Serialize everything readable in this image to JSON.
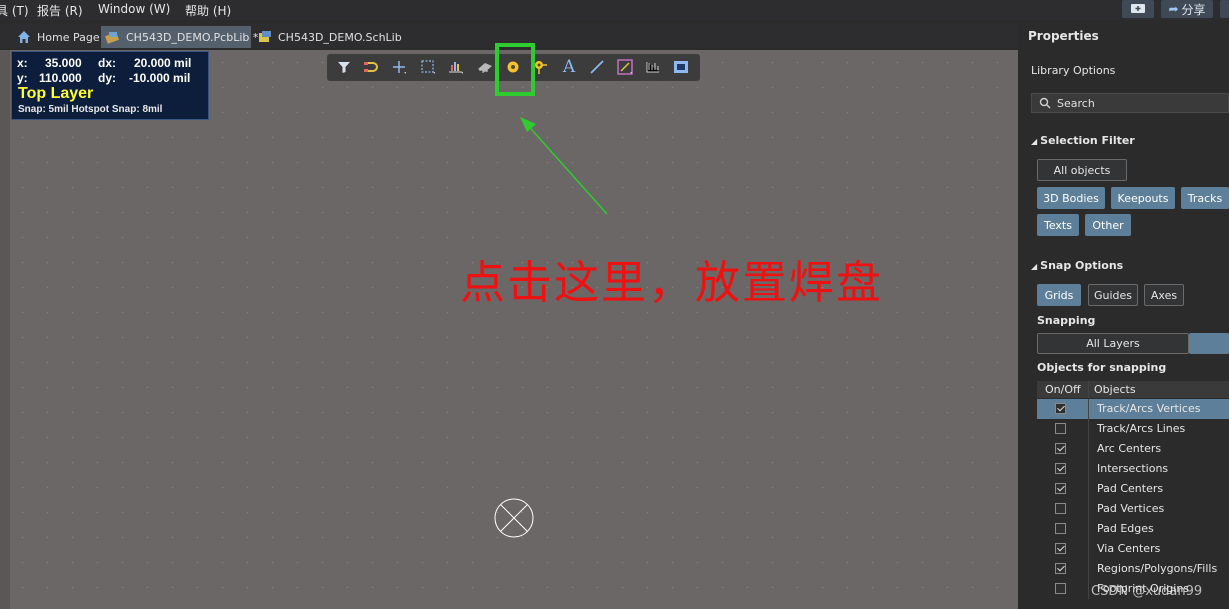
{
  "menubar": {
    "items": [
      "具 (T)",
      "报告 (R)",
      "Window (W)",
      "帮助 (H)"
    ],
    "share_label": "分享"
  },
  "tabs": [
    {
      "label": "Home Page",
      "icon": "home-icon"
    },
    {
      "label": "CH543D_DEMO.PcbLib *",
      "icon": "pcblib-icon"
    },
    {
      "label": "CH543D_DEMO.SchLib",
      "icon": "schlib-icon"
    }
  ],
  "hud": {
    "x_label": "x:",
    "x_value": "35.000",
    "dx_label": "dx:",
    "dx_value": "20.000 mil",
    "y_label": "y:",
    "y_value": "110.000",
    "dy_label": "dy:",
    "dy_value": "-10.000 mil",
    "layer": "Top Layer",
    "snap": "Snap: 5mil Hotspot Snap: 8mil"
  },
  "toolbar": {
    "tools": [
      "filter-icon",
      "interactive-route-icon",
      "place-component-icon",
      "select-rect-icon",
      "chart-icon",
      "component-icon",
      "place-pad-icon",
      "place-via-icon",
      "place-text-icon",
      "place-line-icon",
      "place-region-icon",
      "dimension-icon",
      "layer-icon"
    ]
  },
  "annotation": {
    "text": "点击这里，放置焊盘"
  },
  "properties": {
    "title": "Properties",
    "library_options": "Library Options",
    "search_placeholder": "Search",
    "selection_filter": {
      "heading": "Selection Filter",
      "all_objects": "All objects",
      "buttons": [
        "3D Bodies",
        "Keepouts",
        "Tracks",
        "Texts",
        "Other"
      ]
    },
    "snap_options": {
      "heading": "Snap Options",
      "buttons": [
        "Grids",
        "Guides",
        "Axes"
      ],
      "snapping_label": "Snapping",
      "snapping_value": "All Layers",
      "objects_label": "Objects for snapping",
      "col_onoff": "On/Off",
      "col_objects": "Objects",
      "objects": [
        {
          "label": "Track/Arcs Vertices",
          "checked": true,
          "selected": true
        },
        {
          "label": "Track/Arcs Lines",
          "checked": false
        },
        {
          "label": "Arc Centers",
          "checked": true
        },
        {
          "label": "Intersections",
          "checked": true
        },
        {
          "label": "Pad Centers",
          "checked": true
        },
        {
          "label": "Pad Vertices",
          "checked": false
        },
        {
          "label": "Pad Edges",
          "checked": false
        },
        {
          "label": "Via Centers",
          "checked": true
        },
        {
          "label": "Regions/Polygons/Fills",
          "checked": true
        },
        {
          "label": "Footprint Origins",
          "checked": false
        }
      ]
    }
  },
  "watermark": "CSDN @xudan99"
}
